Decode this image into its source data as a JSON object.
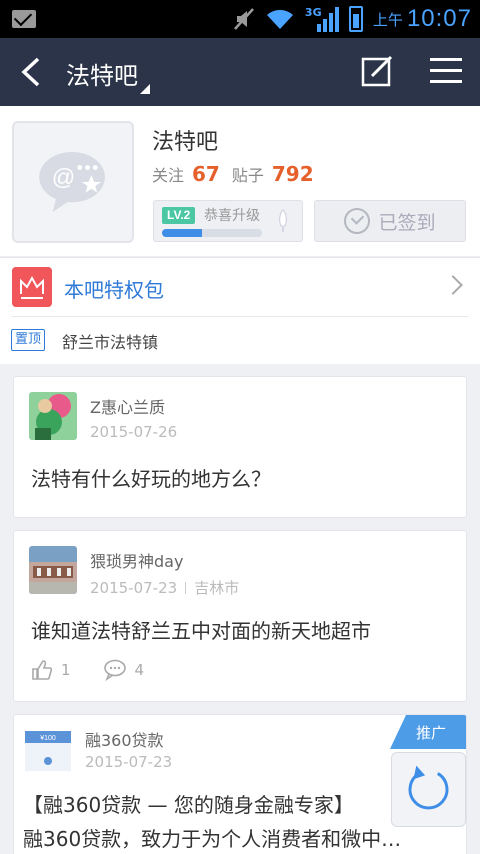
{
  "status_bar": {
    "ampm": "上午",
    "time": "10:07",
    "network": "3G",
    "accent_color": "#4aa3ff"
  },
  "nav": {
    "title": "法特吧",
    "back_icon": "back-arrow-icon",
    "edit_icon": "compose-icon",
    "menu_icon": "hamburger-menu-icon",
    "bg_color": "#2b3448"
  },
  "forum": {
    "name": "法特吧",
    "follow_label": "关注",
    "follow_count": "67",
    "posts_label": "贴子",
    "posts_count": "792",
    "level_badge": "LV.2",
    "level_text": "恭喜升级",
    "level_progress": 0.4,
    "signed_label": "已签到"
  },
  "privilege": {
    "label": "本吧特权包"
  },
  "pinned": {
    "tag": "置顶",
    "text": "舒兰市法特镇"
  },
  "posts": [
    {
      "user": "Z惠心兰质",
      "date": "2015-07-26",
      "location": "",
      "title": "法特有什么好玩的地方么？"
    },
    {
      "user": "猥琐男神day",
      "date": "2015-07-23",
      "location": "吉林市",
      "title": "谁知道法特舒兰五中对面的新天地超市",
      "likes": "1",
      "comments": "4"
    }
  ],
  "ad": {
    "tag": "推广",
    "user": "融360贷款",
    "date": "2015-07-23",
    "thumb_text": "¥100",
    "line1": "【融360贷款 — 您的随身金融专家】",
    "line2": "融360贷款，致力于为个人消费者和微中…"
  }
}
